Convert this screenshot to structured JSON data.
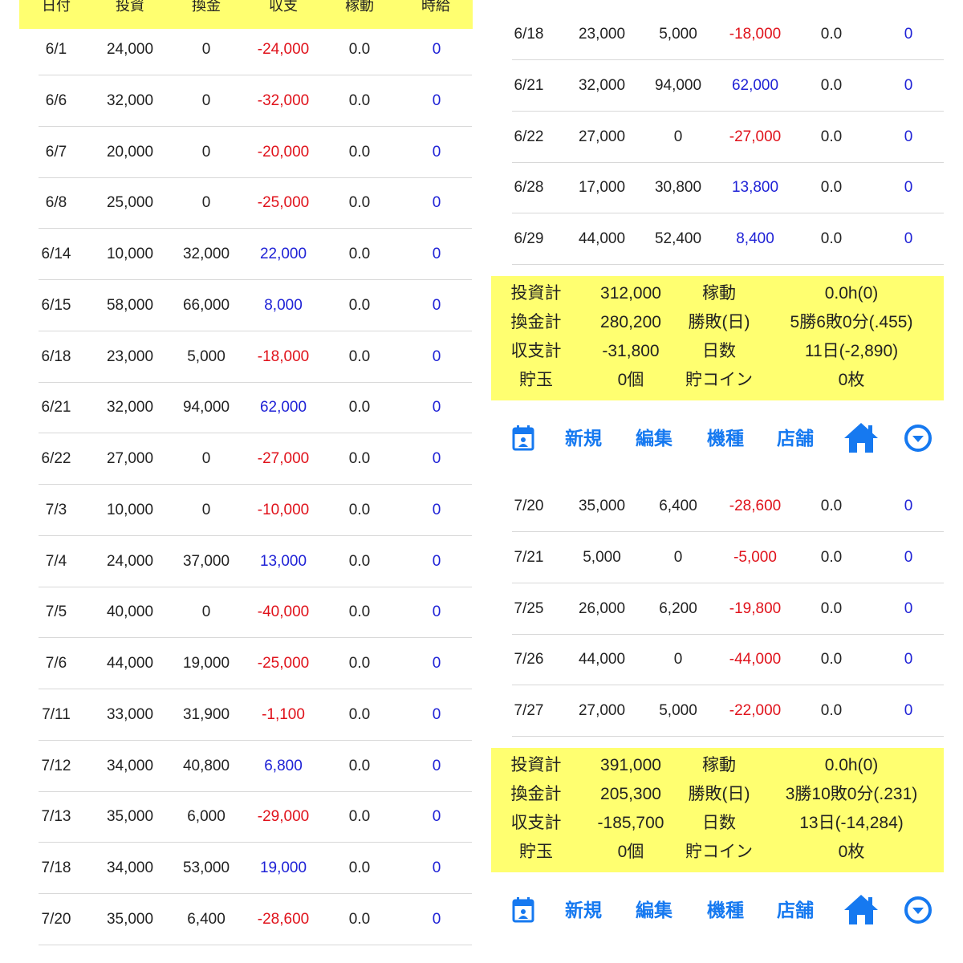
{
  "colors": {
    "accent": "#1679f0",
    "negative": "#e0121b",
    "positive": "#1f22d6",
    "highlight": "#ffff70"
  },
  "left_panel": {
    "rows": [
      {
        "date": "6/1",
        "invest": "24,000",
        "exchange": "0",
        "balance": "-24,000",
        "uptime": "0.0",
        "time": "0"
      },
      {
        "date": "6/6",
        "invest": "32,000",
        "exchange": "0",
        "balance": "-32,000",
        "uptime": "0.0",
        "time": "0"
      },
      {
        "date": "6/7",
        "invest": "20,000",
        "exchange": "0",
        "balance": "-20,000",
        "uptime": "0.0",
        "time": "0"
      },
      {
        "date": "6/8",
        "invest": "25,000",
        "exchange": "0",
        "balance": "-25,000",
        "uptime": "0.0",
        "time": "0"
      },
      {
        "date": "6/14",
        "invest": "10,000",
        "exchange": "32,000",
        "balance": "22,000",
        "uptime": "0.0",
        "time": "0"
      },
      {
        "date": "6/15",
        "invest": "58,000",
        "exchange": "66,000",
        "balance": "8,000",
        "uptime": "0.0",
        "time": "0"
      },
      {
        "date": "6/18",
        "invest": "23,000",
        "exchange": "5,000",
        "balance": "-18,000",
        "uptime": "0.0",
        "time": "0"
      },
      {
        "date": "6/21",
        "invest": "32,000",
        "exchange": "94,000",
        "balance": "62,000",
        "uptime": "0.0",
        "time": "0"
      },
      {
        "date": "6/22",
        "invest": "27,000",
        "exchange": "0",
        "balance": "-27,000",
        "uptime": "0.0",
        "time": "0"
      },
      {
        "date": "7/3",
        "invest": "10,000",
        "exchange": "0",
        "balance": "-10,000",
        "uptime": "0.0",
        "time": "0"
      },
      {
        "date": "7/4",
        "invest": "24,000",
        "exchange": "37,000",
        "balance": "13,000",
        "uptime": "0.0",
        "time": "0"
      },
      {
        "date": "7/5",
        "invest": "40,000",
        "exchange": "0",
        "balance": "-40,000",
        "uptime": "0.0",
        "time": "0"
      },
      {
        "date": "7/6",
        "invest": "44,000",
        "exchange": "19,000",
        "balance": "-25,000",
        "uptime": "0.0",
        "time": "0"
      },
      {
        "date": "7/11",
        "invest": "33,000",
        "exchange": "31,900",
        "balance": "-1,100",
        "uptime": "0.0",
        "time": "0"
      },
      {
        "date": "7/12",
        "invest": "34,000",
        "exchange": "40,800",
        "balance": "6,800",
        "uptime": "0.0",
        "time": "0"
      },
      {
        "date": "7/13",
        "invest": "35,000",
        "exchange": "6,000",
        "balance": "-29,000",
        "uptime": "0.0",
        "time": "0"
      },
      {
        "date": "7/18",
        "invest": "34,000",
        "exchange": "53,000",
        "balance": "19,000",
        "uptime": "0.0",
        "time": "0"
      },
      {
        "date": "7/20",
        "invest": "35,000",
        "exchange": "6,400",
        "balance": "-28,600",
        "uptime": "0.0",
        "time": "0"
      }
    ]
  },
  "header_partial": [
    "日付",
    "投資",
    "換金",
    "収支",
    "稼動",
    "時給"
  ],
  "right_top_panel": {
    "rows": [
      {
        "date": "6/18",
        "invest": "23,000",
        "exchange": "5,000",
        "balance": "-18,000",
        "uptime": "0.0",
        "time": "0"
      },
      {
        "date": "6/21",
        "invest": "32,000",
        "exchange": "94,000",
        "balance": "62,000",
        "uptime": "0.0",
        "time": "0"
      },
      {
        "date": "6/22",
        "invest": "27,000",
        "exchange": "0",
        "balance": "-27,000",
        "uptime": "0.0",
        "time": "0"
      },
      {
        "date": "6/28",
        "invest": "17,000",
        "exchange": "30,800",
        "balance": "13,800",
        "uptime": "0.0",
        "time": "0"
      },
      {
        "date": "6/29",
        "invest": "44,000",
        "exchange": "52,400",
        "balance": "8,400",
        "uptime": "0.0",
        "time": "0"
      }
    ],
    "summary": {
      "invest_label": "投資計",
      "invest_value": "312,000",
      "uptime_label": "稼動",
      "uptime_value": "0.0h(0)",
      "exchange_label": "換金計",
      "exchange_value": "280,200",
      "record_label": "勝敗(日)",
      "record_value": "5勝6敗0分(.455)",
      "balance_label": "収支計",
      "balance_value": "-31,800",
      "days_label": "日数",
      "days_value": "11日(-2,890)",
      "balls_label": "貯玉",
      "balls_value": "0個",
      "coins_label": "貯コイン",
      "coins_value": "0枚"
    }
  },
  "right_bottom_panel": {
    "rows": [
      {
        "date": "7/20",
        "invest": "35,000",
        "exchange": "6,400",
        "balance": "-28,600",
        "uptime": "0.0",
        "time": "0"
      },
      {
        "date": "7/21",
        "invest": "5,000",
        "exchange": "0",
        "balance": "-5,000",
        "uptime": "0.0",
        "time": "0"
      },
      {
        "date": "7/25",
        "invest": "26,000",
        "exchange": "6,200",
        "balance": "-19,800",
        "uptime": "0.0",
        "time": "0"
      },
      {
        "date": "7/26",
        "invest": "44,000",
        "exchange": "0",
        "balance": "-44,000",
        "uptime": "0.0",
        "time": "0"
      },
      {
        "date": "7/27",
        "invest": "27,000",
        "exchange": "5,000",
        "balance": "-22,000",
        "uptime": "0.0",
        "time": "0"
      }
    ],
    "summary": {
      "invest_label": "投資計",
      "invest_value": "391,000",
      "uptime_label": "稼動",
      "uptime_value": "0.0h(0)",
      "exchange_label": "換金計",
      "exchange_value": "205,300",
      "record_label": "勝敗(日)",
      "record_value": "3勝10敗0分(.231)",
      "balance_label": "収支計",
      "balance_value": "-185,700",
      "days_label": "日数",
      "days_value": "13日(-14,284)",
      "balls_label": "貯玉",
      "balls_value": "0個",
      "coins_label": "貯コイン",
      "coins_value": "0枚"
    }
  },
  "toolbar": {
    "new_label": "新規",
    "edit_label": "編集",
    "model_label": "機種",
    "store_label": "店舗",
    "icons": [
      "calendar-icon",
      "home-icon",
      "chevron-down-circle-icon"
    ]
  }
}
